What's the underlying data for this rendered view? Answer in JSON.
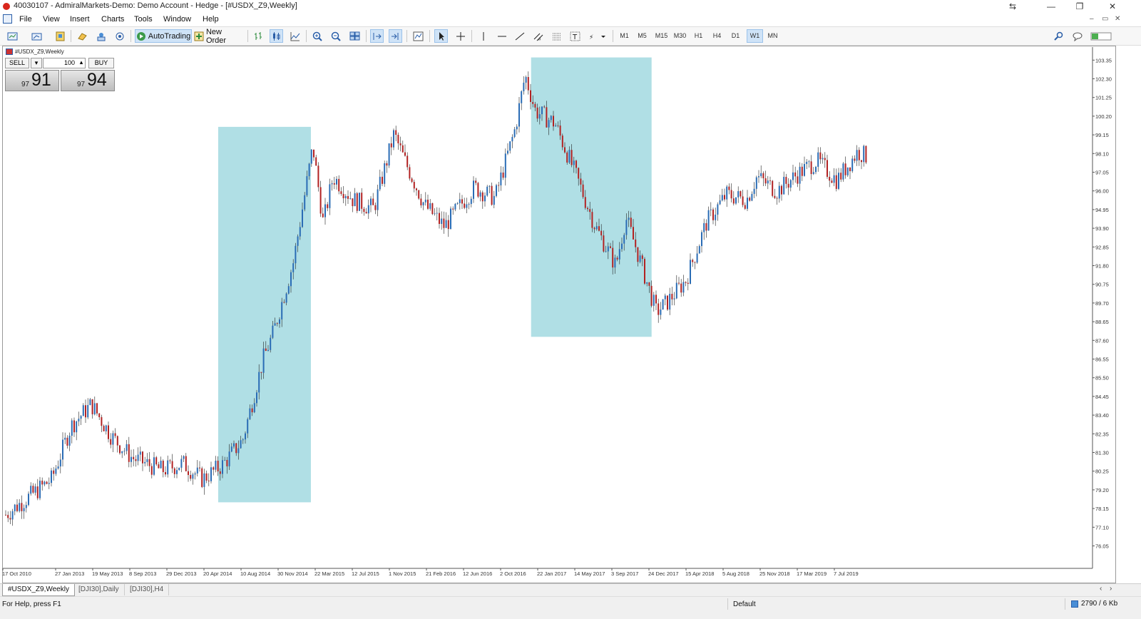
{
  "window": {
    "title": "40030107 - AdmiralMarkets-Demo: Demo Account - Hedge - [#USDX_Z9,Weekly]",
    "controls": [
      "⇆",
      "—",
      "❐",
      "✕"
    ]
  },
  "menu": {
    "items": [
      "File",
      "View",
      "Insert",
      "Charts",
      "Tools",
      "Window",
      "Help"
    ],
    "mdi_controls": [
      "–",
      "▭",
      "✕"
    ]
  },
  "toolbar": {
    "autotrading_label": "AutoTrading",
    "new_order_label": "New Order",
    "timeframes": [
      "M1",
      "M5",
      "M15",
      "M30",
      "H1",
      "H4",
      "D1",
      "W1",
      "MN"
    ],
    "active_timeframe": "W1"
  },
  "chart": {
    "label": "#USDX_Z9,Weekly"
  },
  "one_click": {
    "sell_label": "SELL",
    "buy_label": "BUY",
    "quantity": "100",
    "sell_price_small": "97",
    "sell_price_big": "91",
    "buy_price_small": "97",
    "buy_price_big": "94"
  },
  "tabs": [
    {
      "label": "#USDX_Z9,Weekly",
      "active": true
    },
    {
      "label": "[DJI30],Daily",
      "active": false
    },
    {
      "label": "[DJI30],H4",
      "active": false
    }
  ],
  "status": {
    "help_text": "For Help, press F1",
    "profile": "Default",
    "network": "2790 / 6 Kb"
  },
  "chart_data": {
    "type": "candlestick",
    "symbol": "#USDX_Z9",
    "timeframe": "Weekly",
    "y_ticks": [
      "103.35",
      "102.30",
      "101.25",
      "100.20",
      "99.15",
      "98.10",
      "97.05",
      "96.00",
      "94.95",
      "93.90",
      "92.85",
      "91.80",
      "90.75",
      "89.70",
      "88.65",
      "87.60",
      "86.55",
      "85.50",
      "84.45",
      "83.40",
      "82.35",
      "81.30",
      "80.25",
      "79.20",
      "78.15",
      "77.10",
      "76.05"
    ],
    "x_ticks": [
      "17 Oct 2010",
      "27 Jan 2013",
      "19 May 2013",
      "8 Sep 2013",
      "29 Dec 2013",
      "20 Apr 2014",
      "10 Aug 2014",
      "30 Nov 2014",
      "22 Mar 2015",
      "12 Jul 2015",
      "1 Nov 2015",
      "21 Feb 2016",
      "12 Jun 2016",
      "2 Oct 2016",
      "22 Jan 2017",
      "14 May 2017",
      "3 Sep 2017",
      "24 Dec 2017",
      "15 Apr 2018",
      "5 Aug 2018",
      "25 Nov 2018",
      "17 Mar 2019",
      "7 Jul 2019"
    ],
    "ylim": [
      75.5,
      103.9
    ],
    "bull_color": "#2a6cb5",
    "bear_color": "#b22222",
    "highlight_color": "#b0dfe5",
    "highlights": [
      {
        "from": "2 Jun 2014",
        "to": "9 Mar 2015",
        "low": 78.5,
        "high": 99.6
      },
      {
        "from": "2 Jan 2017",
        "to": "1 Jan 2018",
        "low": 87.8,
        "high": 103.5
      }
    ],
    "approx_close_path": [
      [
        "Oct 2010",
        77.8
      ],
      [
        "Jan 2013",
        79.8
      ],
      [
        "Mar 2013",
        82.8
      ],
      [
        "May 2013",
        84.0
      ],
      [
        "Jul 2013",
        82.2
      ],
      [
        "Sep 2013",
        81.0
      ],
      [
        "Dec 2013",
        80.3
      ],
      [
        "Feb 2014",
        80.7
      ],
      [
        "Apr 2014",
        79.8
      ],
      [
        "Jun 2014",
        80.6
      ],
      [
        "Aug 2014",
        82.0
      ],
      [
        "Oct 2014",
        86.5
      ],
      [
        "Nov 2014",
        88.0
      ],
      [
        "Jan 2015",
        92.0
      ],
      [
        "Mar 2015",
        98.5
      ],
      [
        "Apr 2015",
        94.2
      ],
      [
        "May 2015",
        96.8
      ],
      [
        "Jul 2015",
        95.5
      ],
      [
        "Sep 2015",
        95.0
      ],
      [
        "Nov 2015",
        99.2
      ],
      [
        "Dec 2015",
        97.8
      ],
      [
        "Feb 2016",
        95.2
      ],
      [
        "Apr 2016",
        94.0
      ],
      [
        "Jun 2016",
        95.5
      ],
      [
        "Jul 2016",
        96.2
      ],
      [
        "Sep 2016",
        95.6
      ],
      [
        "Nov 2016",
        99.5
      ],
      [
        "Dec 2016",
        102.5
      ],
      [
        "Jan 2017",
        100.5
      ],
      [
        "Mar 2017",
        99.8
      ],
      [
        "May 2017",
        97.0
      ],
      [
        "Jul 2017",
        94.0
      ],
      [
        "Sep 2017",
        91.8
      ],
      [
        "Oct 2017",
        94.5
      ],
      [
        "Nov 2017",
        92.8
      ],
      [
        "Jan 2018",
        89.2
      ],
      [
        "Feb 2018",
        89.7
      ],
      [
        "Apr 2018",
        91.0
      ],
      [
        "Jun 2018",
        94.2
      ],
      [
        "Aug 2018",
        95.8
      ],
      [
        "Oct 2018",
        95.5
      ],
      [
        "Nov 2018",
        96.8
      ],
      [
        "Jan 2019",
        96.0
      ],
      [
        "Mar 2019",
        96.9
      ],
      [
        "May 2019",
        97.7
      ],
      [
        "Jul 2019",
        96.6
      ],
      [
        "Sep 2019",
        98.2
      ],
      [
        "Oct 2019",
        97.9
      ]
    ]
  }
}
